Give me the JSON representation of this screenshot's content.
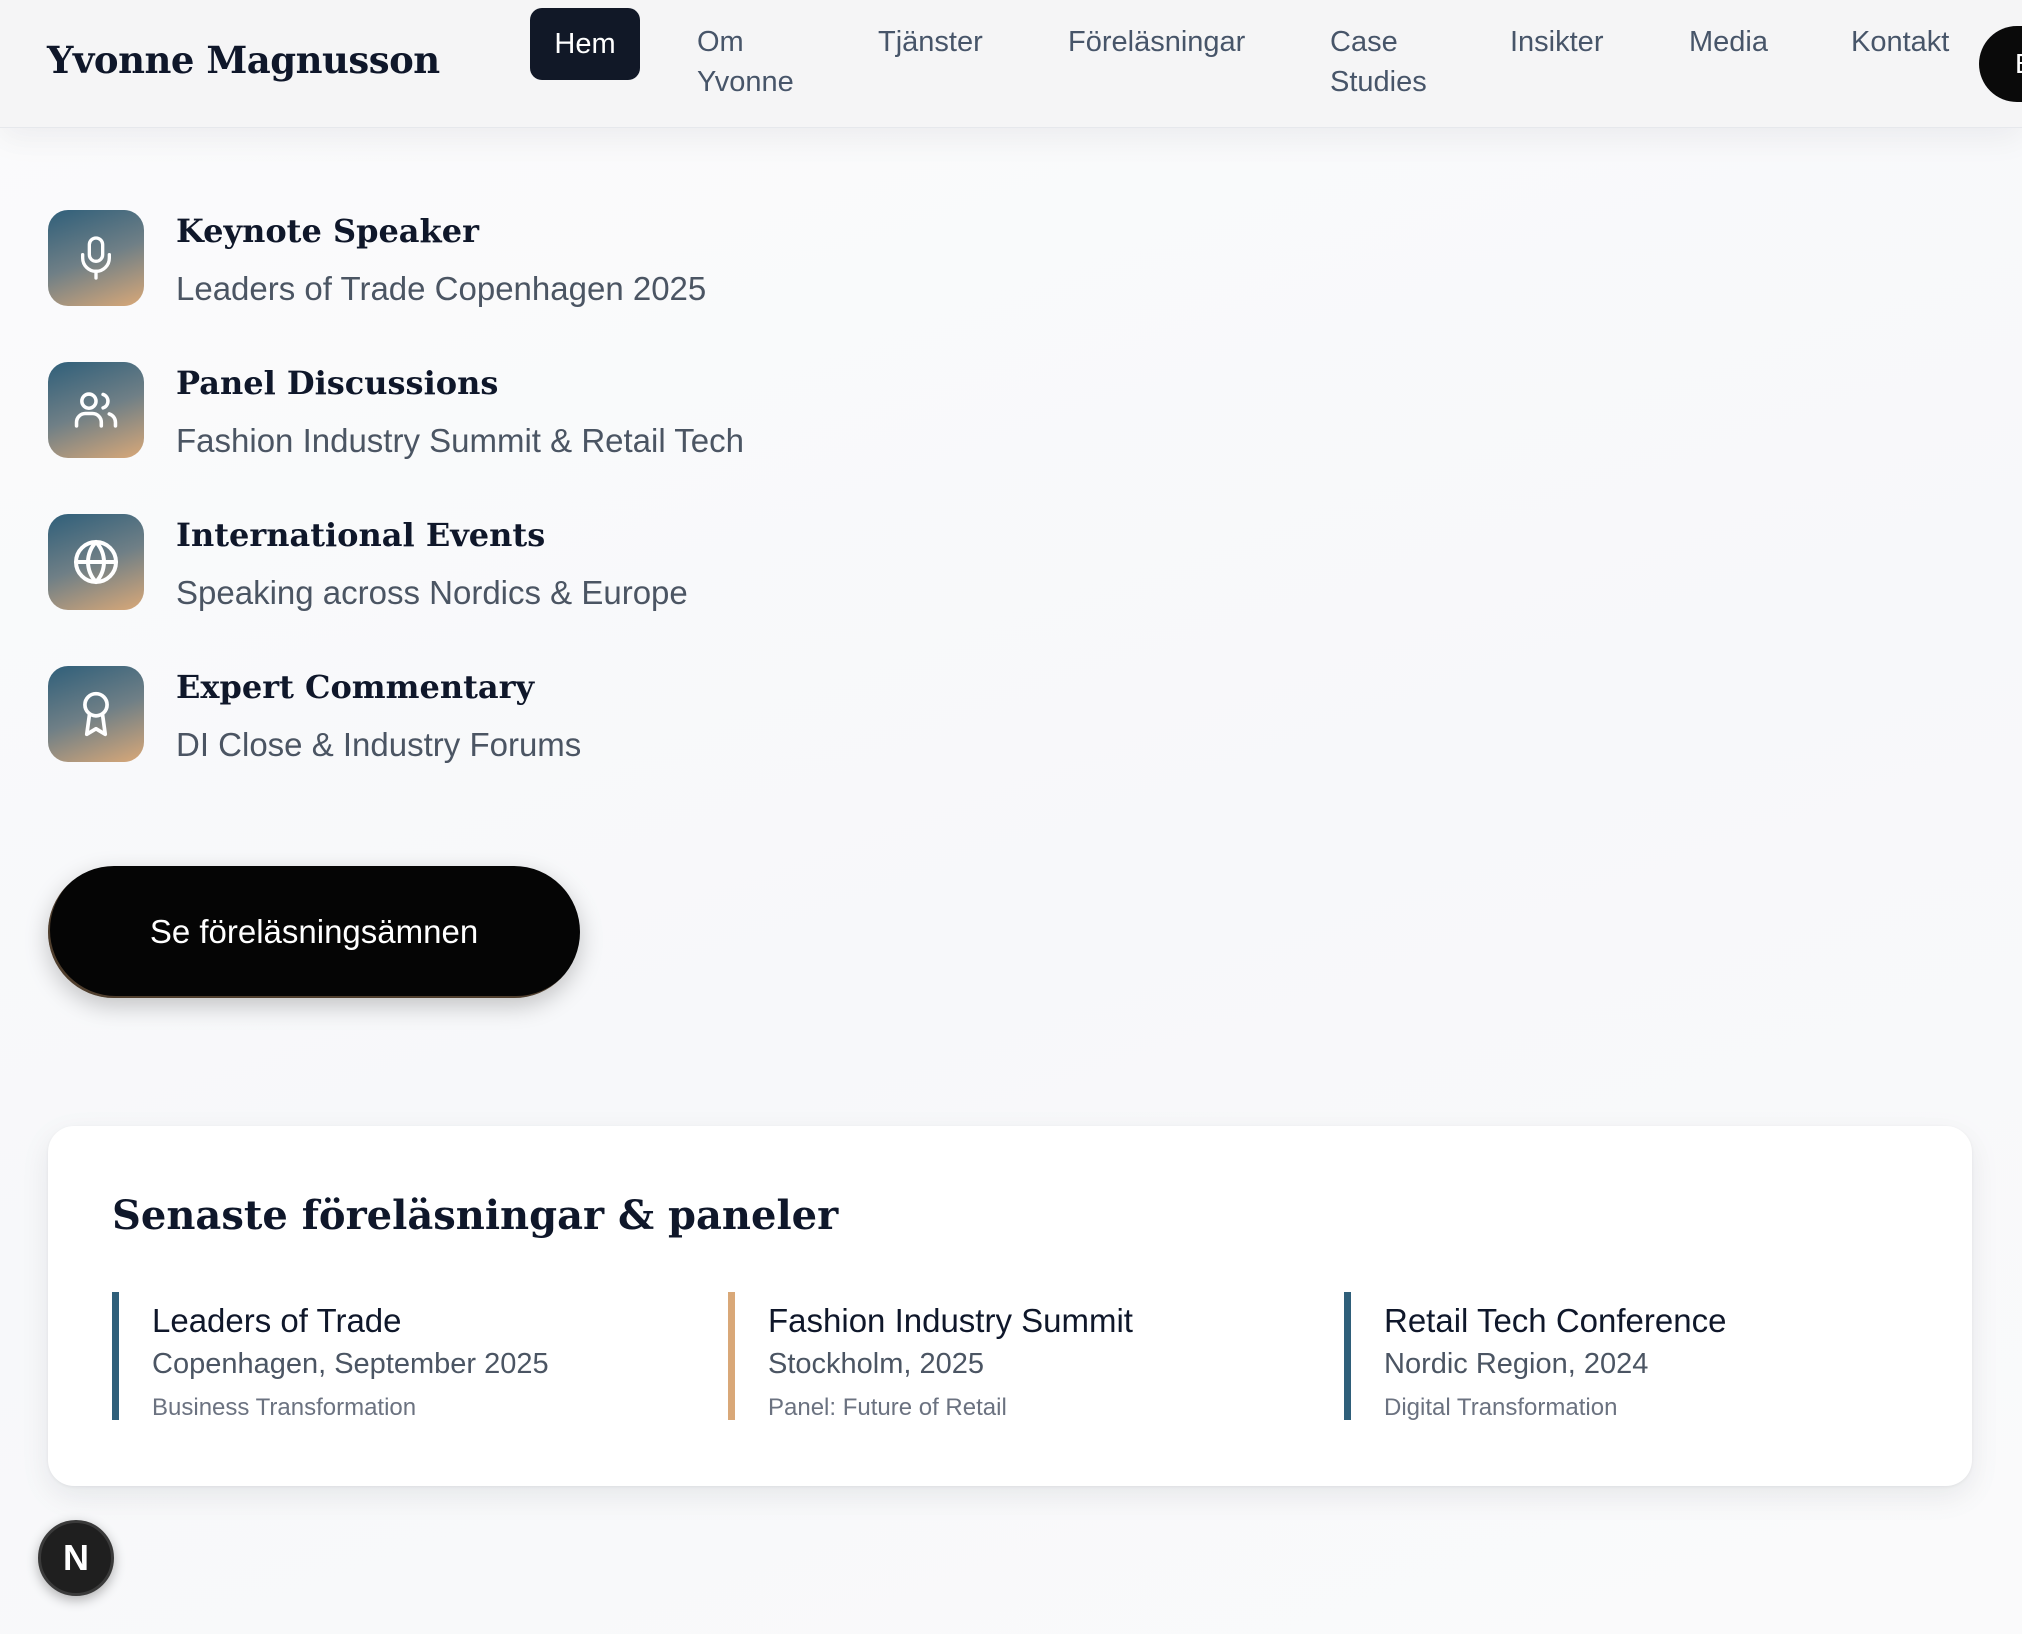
{
  "header": {
    "brand": "Yvonne Magnusson",
    "nav": [
      {
        "label": "Hem",
        "active": true
      },
      {
        "label": "Om Yvonne"
      },
      {
        "label": "Tjänster"
      },
      {
        "label": "Föreläsningar"
      },
      {
        "label": "Case Studies"
      },
      {
        "label": "Insikter"
      },
      {
        "label": "Media"
      },
      {
        "label": "Kontakt"
      }
    ],
    "cta_partial": "B"
  },
  "features": [
    {
      "icon": "microphone-icon",
      "title": "Keynote Speaker",
      "subtitle": "Leaders of Trade Copenhagen 2025"
    },
    {
      "icon": "users-icon",
      "title": "Panel Discussions",
      "subtitle": "Fashion Industry Summit & Retail Tech"
    },
    {
      "icon": "globe-icon",
      "title": "International Events",
      "subtitle": "Speaking across Nordics & Europe"
    },
    {
      "icon": "award-icon",
      "title": "Expert Commentary",
      "subtitle": "DI Close & Industry Forums"
    }
  ],
  "cta_button": "Se föreläsningsämnen",
  "recent": {
    "title": "Senaste föreläsningar & paneler",
    "talks": [
      {
        "name": "Leaders of Trade",
        "place": "Copenhagen, September 2025",
        "topic": "Business Transformation",
        "accent": "#2f5f7a"
      },
      {
        "name": "Fashion Industry Summit",
        "place": "Stockholm, 2025",
        "topic": "Panel: Future of Retail",
        "accent": "#d9a878"
      },
      {
        "name": "Retail Tech Conference",
        "place": "Nordic Region, 2024",
        "topic": "Digital Transformation",
        "accent": "#2f5f7a"
      }
    ]
  },
  "dev_badge": "N",
  "colors": {
    "primary": "#111827",
    "accent_blue": "#2f5f7a",
    "accent_gold": "#d9a878"
  }
}
